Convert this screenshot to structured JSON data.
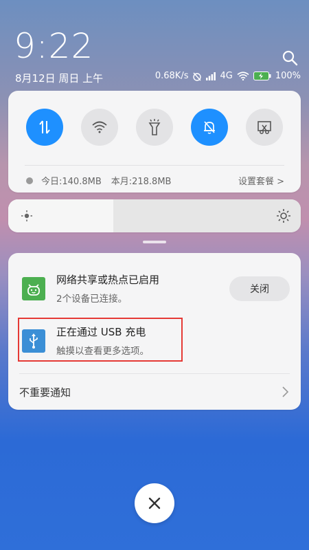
{
  "status": {
    "time": "9:22",
    "date": "8月12日 周日 上午",
    "speed": "0.68K/s",
    "network": "4G",
    "battery": "100%"
  },
  "data_usage": {
    "today": "今日:140.8MB",
    "month": "本月:218.8MB",
    "settings_link": "设置套餐 >"
  },
  "quick_toggles": [
    {
      "icon": "mobile-data-icon",
      "active": true
    },
    {
      "icon": "wifi-icon",
      "active": false
    },
    {
      "icon": "flashlight-icon",
      "active": false
    },
    {
      "icon": "mute-bell-icon",
      "active": true
    },
    {
      "icon": "screenshot-icon",
      "active": false
    }
  ],
  "brightness": {
    "level": 0.36
  },
  "notifications": [
    {
      "title": "网络共享或热点已启用",
      "subtitle": "2个设备已连接。",
      "action": "关闭",
      "icon_color": "#4caf50"
    },
    {
      "title": "正在通过 USB 充电",
      "subtitle": "触摸以查看更多选项。",
      "icon_color": "#3b8fd6"
    }
  ],
  "unimportant": {
    "label": "不重要通知"
  },
  "colors": {
    "accent": "#1e90ff",
    "highlight": "#e53935"
  }
}
